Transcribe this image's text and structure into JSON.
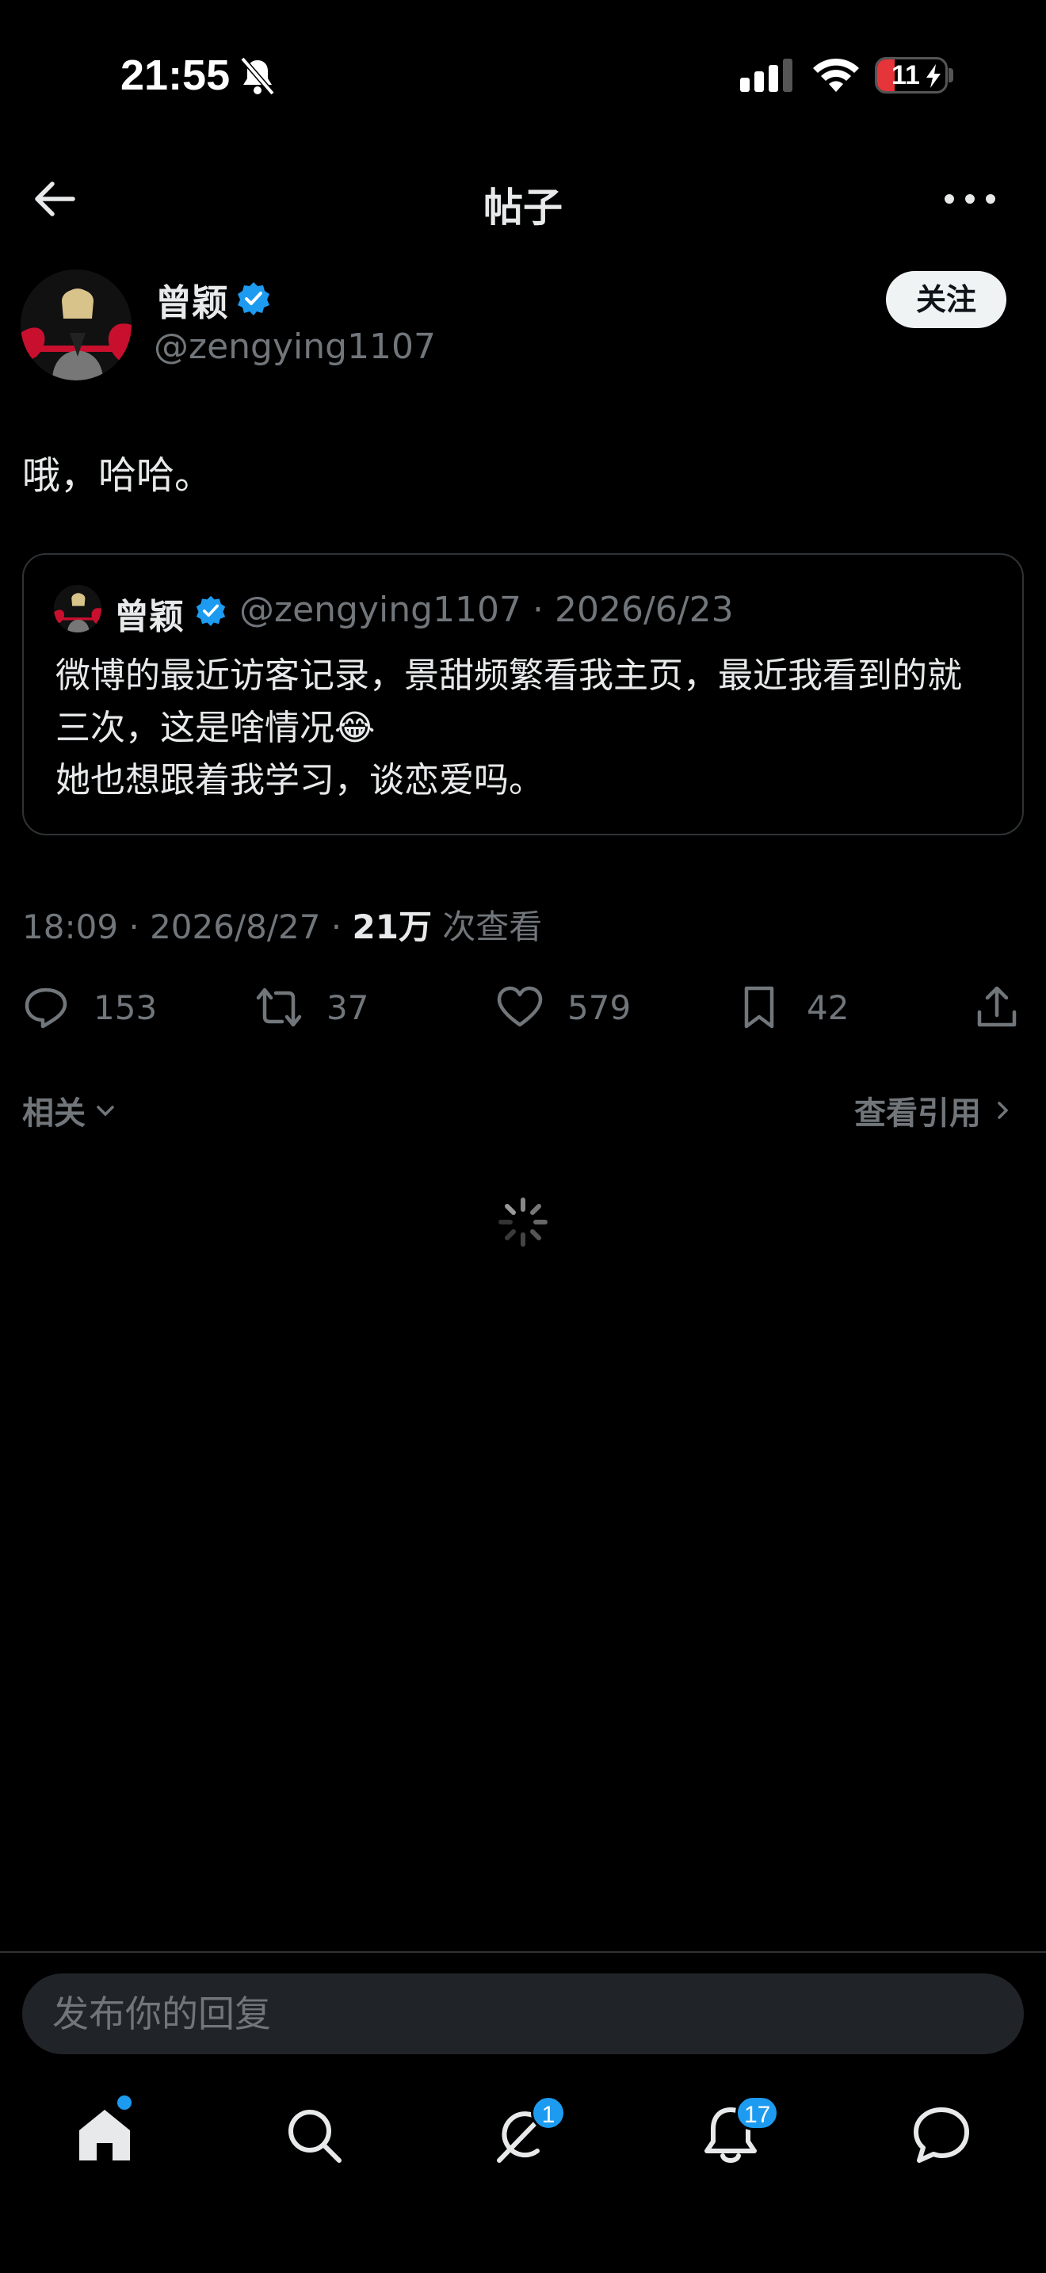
{
  "status_bar": {
    "time": "21:55",
    "battery": "11"
  },
  "nav": {
    "title": "帖子"
  },
  "author": {
    "name": "曾颖",
    "handle": "@zengying1107",
    "follow_label": "关注"
  },
  "post": {
    "text": "哦，哈哈。"
  },
  "quote": {
    "name": "曾颖",
    "meta": "@zengying1107 · 2026/6/23",
    "body": "微博的最近访客记录，景甜频繁看我主页，最近我看到的就三次，这是啥情况😂\n她也想跟着我学习，谈恋爱吗。"
  },
  "meta": {
    "time_date": "18:09 · 2026/8/27 · ",
    "views": "21万",
    "views_label": " 次查看"
  },
  "actions": {
    "replies": "153",
    "retweets": "37",
    "likes": "579",
    "bookmarks": "42"
  },
  "related": {
    "label": "相关",
    "view_quotes": "查看引用"
  },
  "reply": {
    "placeholder": "发布你的回复"
  },
  "tabs": {
    "grok_badge": "1",
    "notifications_badge": "17"
  },
  "colors": {
    "accent": "#1d9bf0",
    "muted": "#71767b",
    "text": "#e7e9ea",
    "battery_low": "#e5343a"
  }
}
